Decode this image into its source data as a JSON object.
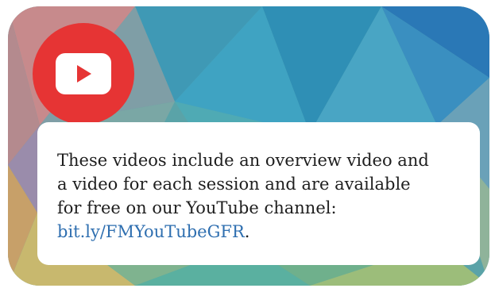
{
  "card": {
    "icon": "youtube-play-icon",
    "colors": {
      "icon_red": "#e63434",
      "link_blue": "#2f6fb0",
      "text": "#1e1e1e"
    },
    "text_lines": [
      "These videos include an overview video and",
      "a video for each session and are available",
      "for free on our YouTube channel:"
    ],
    "link_text": "bit.ly/FMYouTubeGFR",
    "link_suffix": "."
  }
}
